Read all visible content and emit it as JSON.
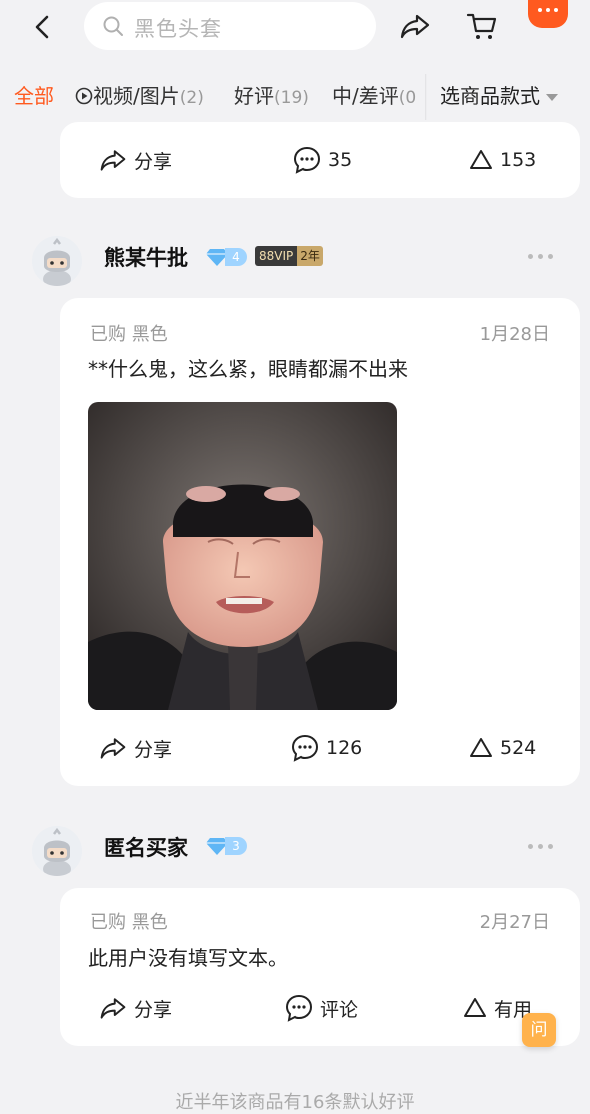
{
  "search": {
    "placeholder": "黑色头套"
  },
  "tabs": {
    "all": "全部",
    "video_label": "视频/图片",
    "video_count": "(2)",
    "good_label": "好评",
    "good_count": "(19)",
    "mid_label": "中/差评",
    "mid_count": "(0",
    "filter": "选商品款式"
  },
  "review0": {
    "share": "分享",
    "comments": "35",
    "likes": "153"
  },
  "review1": {
    "user": "熊某牛批",
    "level": "4",
    "vip": "88VIP",
    "vip_years": "2年",
    "purchase": "已购 黑色",
    "date": "1月28日",
    "text": "**什么鬼，这么紧，眼睛都漏不出来",
    "share": "分享",
    "comments": "126",
    "likes": "524"
  },
  "review2": {
    "user": "匿名买家",
    "level": "3",
    "purchase": "已购 黑色",
    "date": "2月27日",
    "text": "此用户没有填写文本。",
    "share": "分享",
    "comment": "评论",
    "useful": "有用"
  },
  "qa": "问",
  "footer": "近半年该商品有16条默认好评",
  "colors": {
    "accent": "#ff5a1f",
    "diamond": "#9fd4ff",
    "vip_gold": "#c9a86a"
  },
  "icons": [
    "back-icon",
    "search-icon",
    "share-icon",
    "cart-icon",
    "more-icon",
    "comment-icon",
    "like-icon",
    "diamond-icon"
  ]
}
